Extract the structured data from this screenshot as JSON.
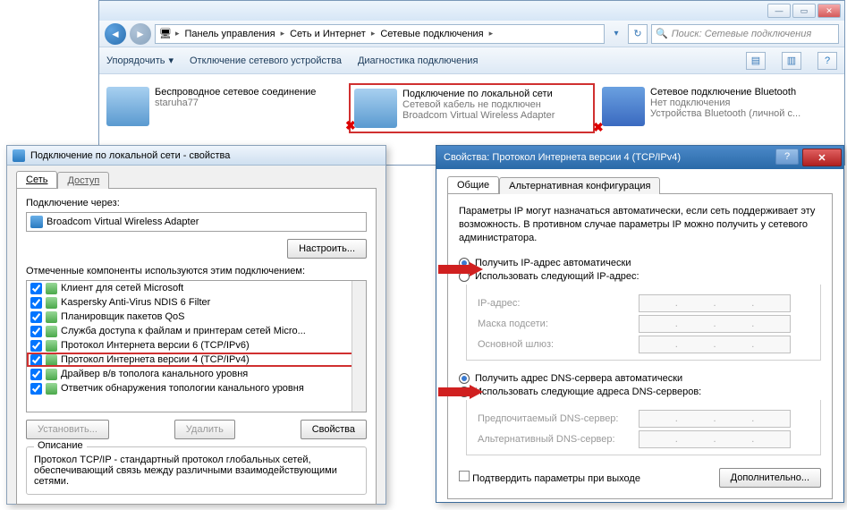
{
  "explorer": {
    "breadcrumb": [
      "Панель управления",
      "Сеть и Интернет",
      "Сетевые подключения"
    ],
    "search_placeholder": "Поиск: Сетевые подключения",
    "cmd": {
      "organize": "Упорядочить",
      "disable": "Отключение сетевого устройства",
      "diagnose": "Диагностика подключения"
    },
    "connections": [
      {
        "name": "Беспроводное сетевое соединение",
        "status": "",
        "device": "staruha77",
        "hasX": false
      },
      {
        "name": "Подключение по локальной сети",
        "status": "Сетевой кабель не подключен",
        "device": "Broadcom Virtual Wireless Adapter",
        "hasX": true
      },
      {
        "name": "Сетевое подключение Bluetooth",
        "status": "Нет подключения",
        "device": "Устройства Bluetooth (личной с...",
        "hasX": true
      }
    ]
  },
  "props": {
    "title": "Подключение по локальной сети - свойства",
    "tabs": {
      "network": "Сеть",
      "access": "Доступ"
    },
    "connect_via_label": "Подключение через:",
    "adapter": "Broadcom Virtual Wireless Adapter",
    "configure": "Настроить...",
    "components_label": "Отмеченные компоненты используются этим подключением:",
    "components": [
      "Клиент для сетей Microsoft",
      "Kaspersky Anti-Virus NDIS 6 Filter",
      "Планировщик пакетов QoS",
      "Служба доступа к файлам и принтерам сетей Micro...",
      "Протокол Интернета версии 6 (TCP/IPv6)",
      "Протокол Интернета версии 4 (TCP/IPv4)",
      "Драйвер в/в тополога канального уровня",
      "Ответчик обнаружения топологии канального уровня"
    ],
    "install": "Установить...",
    "remove": "Удалить",
    "properties": "Свойства",
    "desc_legend": "Описание",
    "desc_text": "Протокол TCP/IP - стандартный протокол глобальных сетей, обеспечивающий связь между различными взаимодействующими сетями."
  },
  "ipv4": {
    "title": "Свойства: Протокол Интернета версии 4 (TCP/IPv4)",
    "tabs": {
      "general": "Общие",
      "altcfg": "Альтернативная конфигурация"
    },
    "info": "Параметры IP могут назначаться автоматически, если сеть поддерживает эту возможность. В противном случае параметры IP можно получить у сетевого администратора.",
    "radio_ip_auto": "Получить IP-адрес автоматически",
    "radio_ip_manual": "Использовать следующий IP-адрес:",
    "lbl_ip": "IP-адрес:",
    "lbl_mask": "Маска подсети:",
    "lbl_gw": "Основной шлюз:",
    "radio_dns_auto": "Получить адрес DNS-сервера автоматически",
    "radio_dns_manual": "Использовать следующие адреса DNS-серверов:",
    "lbl_dns1": "Предпочитаемый DNS-сервер:",
    "lbl_dns2": "Альтернативный DNS-сервер:",
    "validate_exit": "Подтвердить параметры при выходе",
    "advanced": "Дополнительно..."
  }
}
